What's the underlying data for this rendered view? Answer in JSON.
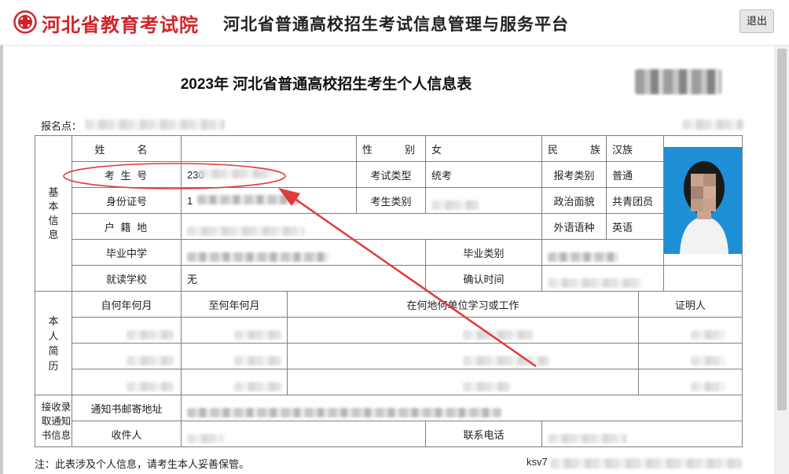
{
  "header": {
    "org_name": "河北省教育考试院",
    "platform_name": "河北省普通高校招生考试信息管理与服务平台",
    "logout_label": "退出"
  },
  "document": {
    "title": "2023年 河北省普通高校招生考生个人信息表",
    "site_label": "报名点：",
    "footer_note": "注：此表涉及个人信息，请考生本人妥善保管。",
    "footer_code_prefix": "ksv7"
  },
  "basic_section": {
    "section_label": "基本信息",
    "name_label": "姓　名",
    "gender_label": "性　别",
    "gender_value": "女",
    "ethnicity_label": "民　族",
    "ethnicity_value": "汉族",
    "exam_no_label": "考 生 号",
    "exam_no_value_start": "23",
    "exam_no_value_end": "0",
    "exam_type_label": "考试类型",
    "exam_type_value": "统考",
    "apply_category_label": "报考类别",
    "apply_category_value": "普通",
    "id_label": "身份证号",
    "id_value_start": "1",
    "candidate_category_label": "考生类别",
    "political_label": "政治面貌",
    "political_value": "共青团员",
    "household_label": "户 籍 地",
    "foreign_lang_label": "外语语种",
    "foreign_lang_value": "英语",
    "grad_school_label": "毕业中学",
    "grad_category_label": "毕业类别",
    "current_school_label": "就读学校",
    "current_school_value": "无",
    "confirm_time_label": "确认时间"
  },
  "resume_section": {
    "section_label": "本人简历",
    "col_from": "自何年何月",
    "col_to": "至何年何月",
    "col_where": "在何地何单位学习或工作",
    "col_witness": "证明人"
  },
  "notice_section": {
    "section_label": "接收录取通知书信息",
    "address_label": "通知书邮寄地址",
    "recipient_label": "收件人",
    "phone_label": "联系电话"
  }
}
